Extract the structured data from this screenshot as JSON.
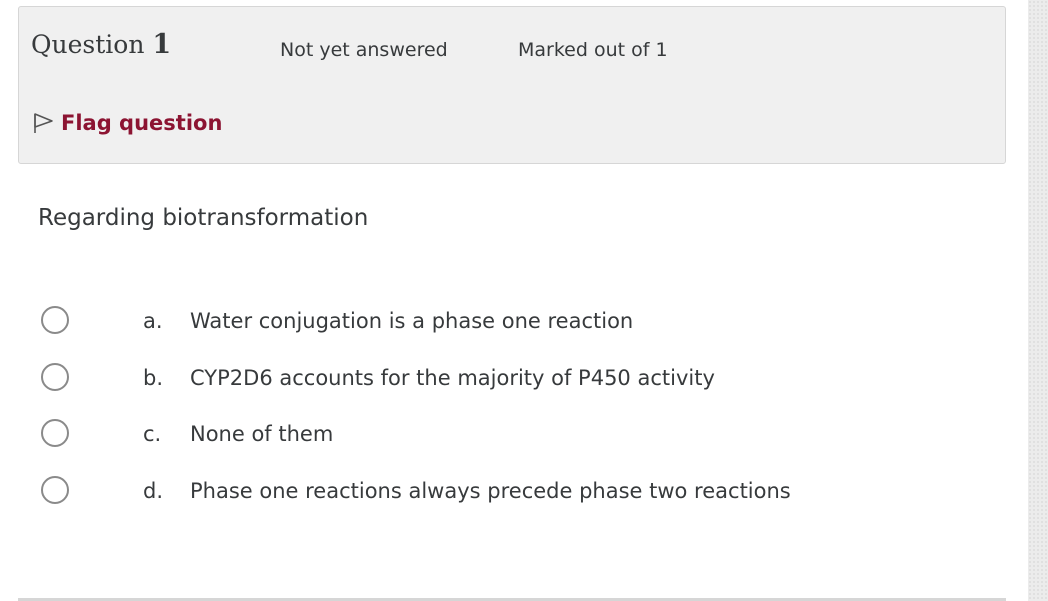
{
  "info": {
    "question_label": "Question",
    "question_number": "1",
    "state": "Not yet answered",
    "grade": "Marked out of 1",
    "flag_label": "Flag question"
  },
  "question": {
    "text": "Regarding biotransformation"
  },
  "answers": [
    {
      "letter": "a.",
      "text": "Water conjugation is a phase one reaction"
    },
    {
      "letter": "b.",
      "text": "CYP2D6 accounts for the majority of P450 activity"
    },
    {
      "letter": "c.",
      "text": "None of them"
    },
    {
      "letter": "d.",
      "text": "Phase one reactions always precede phase two reactions"
    }
  ],
  "colors": {
    "flag": "#8c1432",
    "text": "#373a3c",
    "info_bg": "#f0f0f0",
    "radio_border": "#8a8a8a"
  },
  "icons": {
    "flag": "flag-outline-icon",
    "radio": "radio-unchecked-icon"
  }
}
